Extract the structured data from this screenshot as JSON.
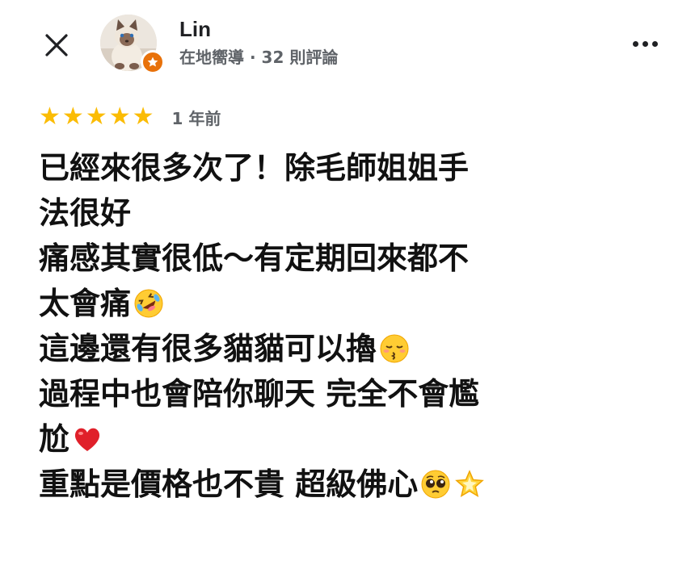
{
  "header": {
    "close_icon": "close-icon",
    "more_icon": "more-options-icon"
  },
  "reviewer": {
    "name": "Lin",
    "meta": "在地嚮導 · 32 則評論",
    "badge_icon": "local-guide-star-icon",
    "avatar": "cat-avatar"
  },
  "review": {
    "rating": 5,
    "rating_max": 5,
    "star_symbol": "★",
    "star_color": "#fbbc04",
    "date": "1 年前",
    "lines": [
      {
        "text": "已經來很多次了！除毛師姐姐手",
        "emoji": ""
      },
      {
        "text": "法很好",
        "emoji": ""
      },
      {
        "text": "痛感其實很低～有定期回來都不",
        "emoji": ""
      },
      {
        "text": "太會痛",
        "emoji": "rolling-laughing-face"
      },
      {
        "text": "這邊還有很多貓貓可以擼",
        "emoji": "kissing-face-closed-eyes"
      },
      {
        "text": "過程中也會陪你聊天 完全不會尷",
        "emoji": ""
      },
      {
        "text": "尬",
        "emoji": "red-heart"
      },
      {
        "text": "重點是價格也不貴 超級佛心",
        "emoji": "pleading-face glowing-star"
      }
    ]
  },
  "colors": {
    "badge": "#e8710a",
    "meta_text": "#5f6368",
    "body_text": "#111111"
  }
}
